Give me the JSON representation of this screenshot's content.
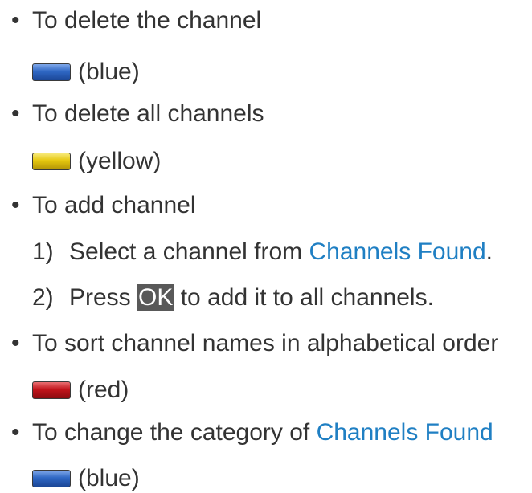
{
  "items": [
    {
      "bullet": "•",
      "text": "To delete the channel",
      "key": {
        "color_name": "(blue)",
        "color": "#2f67c4"
      }
    },
    {
      "bullet": "•",
      "text": "To delete all channels",
      "key": {
        "color_name": "(yellow)",
        "color": "#e6c70e"
      }
    },
    {
      "bullet": "•",
      "text": "To add channel",
      "steps": [
        {
          "num": "1)",
          "before": "Select a channel from ",
          "link": "Channels Found",
          "after": "."
        },
        {
          "num": "2)",
          "before": "Press ",
          "key_label": "OK",
          "after": " to add it to all channels."
        }
      ]
    },
    {
      "bullet": "•",
      "text": "To sort channel names in alphabetical order",
      "key": {
        "color_name": "(red)",
        "color": "#c2141b"
      }
    },
    {
      "bullet": "•",
      "before": "To change the category of ",
      "link": "Channels Found",
      "key": {
        "color_name": "(blue)",
        "color": "#2f67c4"
      }
    }
  ],
  "colors": {
    "text": "#333333",
    "link": "#1f7fc3",
    "ok_key_bg": "#595959",
    "ok_key_text": "#ffffff"
  }
}
